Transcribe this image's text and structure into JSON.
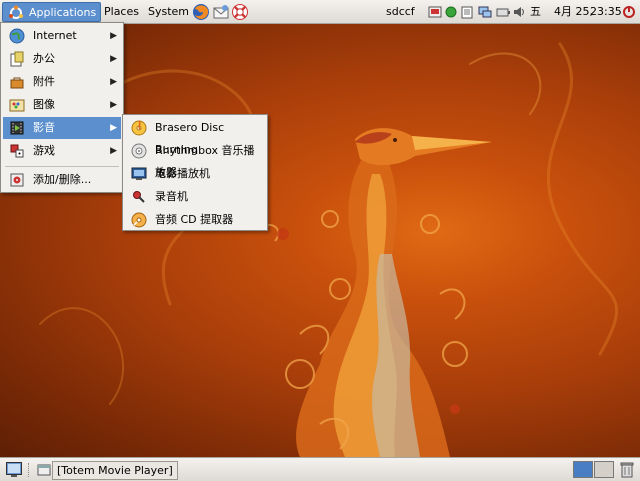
{
  "top_panel": {
    "applications_label": "Applications",
    "places_label": "Places",
    "system_label": "System",
    "launchers": [
      "firefox-icon",
      "mail-icon",
      "help-icon"
    ],
    "username": "sdccf",
    "input_method": "五",
    "date": "4月 25,",
    "time": "23:35"
  },
  "applications_menu": {
    "items": [
      {
        "label": "Internet",
        "icon": "globe-icon",
        "submenu": true
      },
      {
        "label": "办公",
        "icon": "office-icon",
        "submenu": true
      },
      {
        "label": "附件",
        "icon": "accessories-icon",
        "submenu": true
      },
      {
        "label": "图像",
        "icon": "graphics-icon",
        "submenu": true
      },
      {
        "label": "影音",
        "icon": "multimedia-icon",
        "submenu": true,
        "selected": true
      },
      {
        "label": "游戏",
        "icon": "games-icon",
        "submenu": true
      },
      {
        "label": "添加/删除...",
        "icon": "add-remove-icon",
        "submenu": false
      }
    ]
  },
  "multimedia_submenu": {
    "items": [
      {
        "label": "Brasero Disc Burning",
        "icon": "brasero-icon"
      },
      {
        "label": "Rhythmbox 音乐播放器",
        "icon": "rhythmbox-icon"
      },
      {
        "label": "电影播放机",
        "icon": "movie-player-icon"
      },
      {
        "label": "录音机",
        "icon": "sound-recorder-icon"
      },
      {
        "label": "音频 CD 提取器",
        "icon": "cd-extractor-icon"
      }
    ]
  },
  "bottom_panel": {
    "taskbar_window": "[Totem Movie Player]",
    "workspaces": 2
  },
  "colors": {
    "selection": "#5b8fce",
    "panel": "#e8e5e0",
    "wallpaper": "#c8500c"
  }
}
